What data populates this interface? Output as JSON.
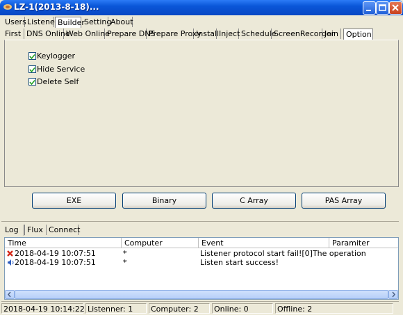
{
  "window": {
    "title": "LZ-1(2013-8-18)..."
  },
  "main_tabs": [
    "Users",
    "Listener",
    "Builder",
    "Setting",
    "About"
  ],
  "builder_tabs": [
    "First",
    "DNS Online",
    "Web Online",
    "Prepare DNS",
    "Prepare Proxy",
    "Install",
    "Inject",
    "Schedule",
    "ScreenRecorder",
    "Join",
    "Option"
  ],
  "options": [
    {
      "label": "Keylogger",
      "checked": true
    },
    {
      "label": "Hide Service",
      "checked": true
    },
    {
      "label": "Delete Self",
      "checked": true
    }
  ],
  "build_buttons": [
    "EXE",
    "Binary",
    "C Array",
    "PAS Array"
  ],
  "log_tabs": [
    "Log",
    "Flux",
    "Connect"
  ],
  "log_columns": [
    "Time",
    "Computer",
    "Event",
    "Paramiter"
  ],
  "log_rows": [
    {
      "icon": "error-icon",
      "time": "2018-04-19 10:07:51",
      "computer": "*",
      "event": "Listener protocol start fail![0]The operation"
    },
    {
      "icon": "speaker-icon",
      "time": "2018-04-19 10:07:51",
      "computer": "*",
      "event": "Listen start success!"
    }
  ],
  "status": {
    "time": "2018-04-19 10:14:22",
    "listenner": "Listenner: 1",
    "computer": "Computer: 2",
    "online": "Online: 0",
    "offline": "Offline: 2"
  }
}
